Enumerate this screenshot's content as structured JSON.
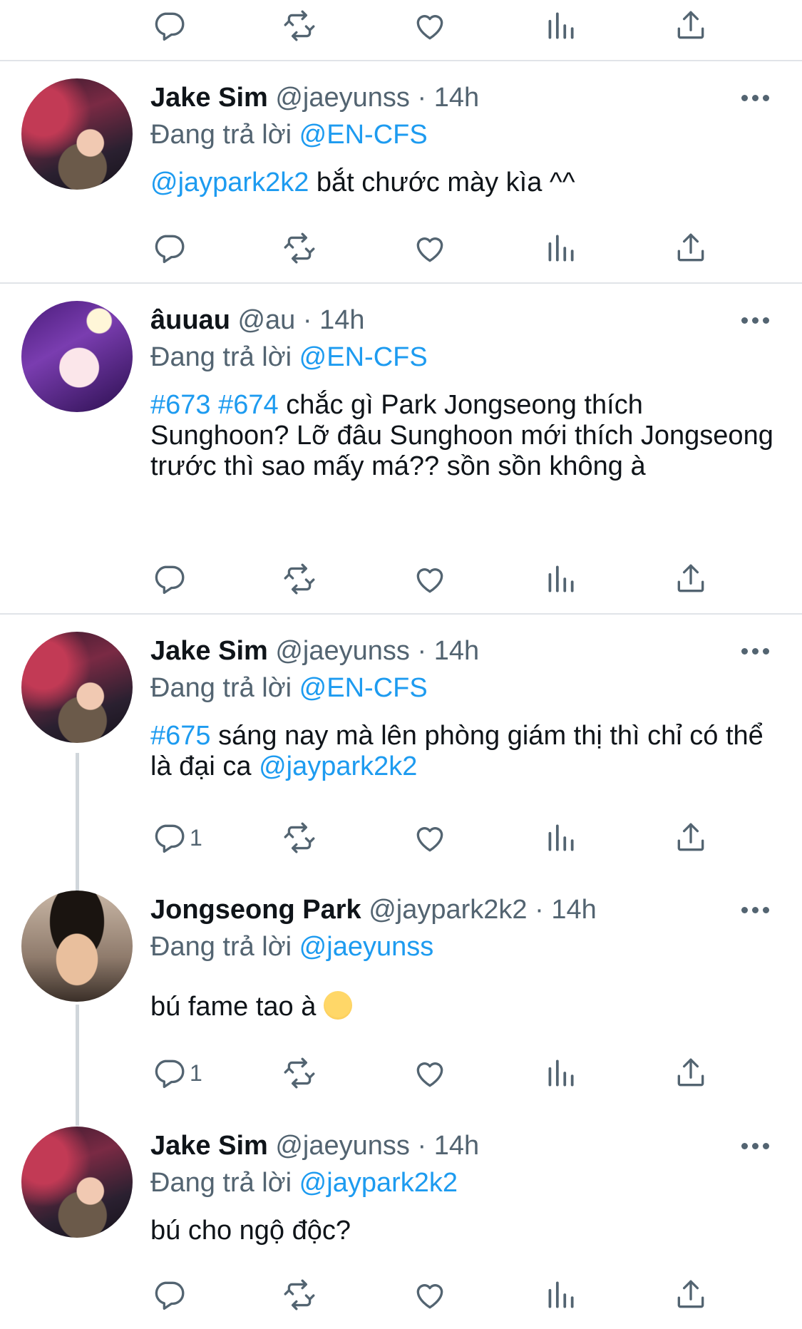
{
  "tweets": [
    {
      "name": "Jake Sim",
      "handle": "@jaeyunss",
      "time": "14h",
      "replying_label": "Đang trả lời",
      "replying_to": "@EN-CFS",
      "mention": "@jaypark2k2",
      "text": " bắt chước mày kìa ^^",
      "avatar": "profile-photo-jake"
    },
    {
      "name": "âuuau",
      "handle": "@au",
      "time": "14h",
      "replying_label": "Đang trả lời",
      "replying_to": "@EN-CFS",
      "tags": "#673 #674",
      "text": " chắc gì Park Jongseong thích Sunghoon? Lỡ đâu Sunghoon mới thích Jongseong trước thì sao mấy má?? sồn sồn không à",
      "avatar": "anime-avatar"
    },
    {
      "name": "Jake Sim",
      "handle": "@jaeyunss",
      "time": "14h",
      "replying_label": "Đang trả lời",
      "replying_to": "@EN-CFS",
      "tags": "#675",
      "text": " sáng nay mà lên phòng giám thị thì chỉ có thể là đại ca ",
      "mention": "@jaypark2k2",
      "reply_count": "1",
      "avatar": "profile-photo-jake"
    },
    {
      "name": "Jongseong Park",
      "handle": "@jaypark2k2",
      "time": "14h",
      "replying_label": "Đang trả lời",
      "replying_to": "@jaeyunss",
      "text": "bú fame tao à ",
      "emoji": "smirking-face-emoji",
      "reply_count": "1",
      "avatar": "profile-photo-jongseong"
    },
    {
      "name": "Jake Sim",
      "handle": "@jaeyunss",
      "time": "14h",
      "replying_label": "Đang trả lời",
      "replying_to": "@jaypark2k2",
      "text": "bú cho ngộ độc?",
      "avatar": "profile-photo-jake"
    }
  ],
  "dot": "·",
  "colors": {
    "link": "#1d9bf0",
    "secondary": "#536471",
    "separator": "#e1e4e8"
  },
  "icons": [
    "reply-icon",
    "retweet-icon",
    "like-icon",
    "analytics-icon",
    "share-icon",
    "more-icon"
  ]
}
